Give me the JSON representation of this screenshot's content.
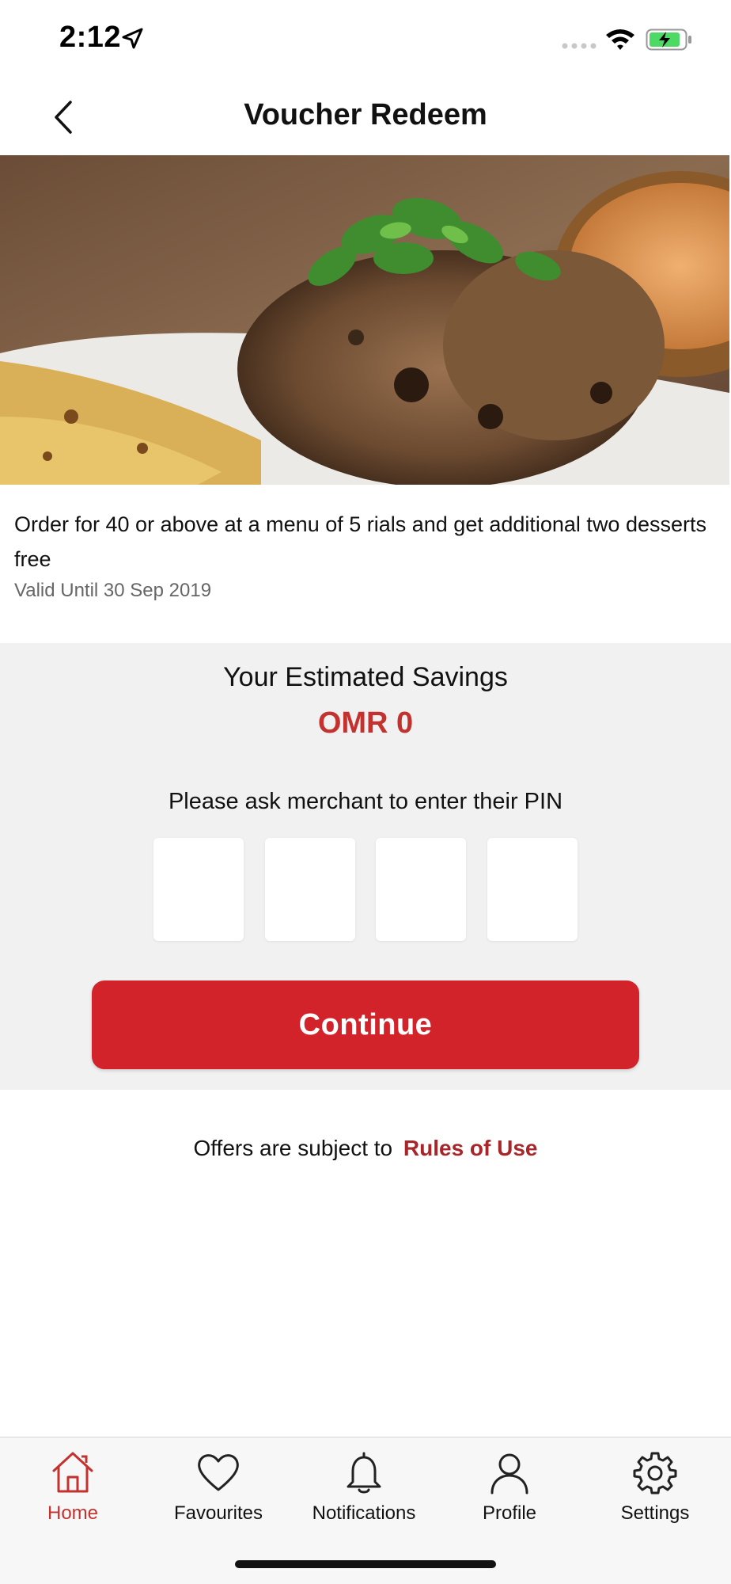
{
  "status_bar": {
    "time": "2:12",
    "icons": [
      "location-arrow-icon",
      "signal-dots-icon",
      "wifi-icon",
      "battery-charging-icon"
    ],
    "battery_color": "#4cd964"
  },
  "header": {
    "title": "Voucher Redeem",
    "back_icon": "chevron-left-icon"
  },
  "offer": {
    "description": "Order for 40 or above at a menu of 5 rials and get additional two desserts free",
    "valid_until": "Valid Until 30 Sep 2019"
  },
  "savings": {
    "label": "Your Estimated Savings",
    "value": "OMR 0"
  },
  "pin": {
    "prompt": "Please ask merchant to enter their PIN",
    "digits": [
      "",
      "",
      "",
      ""
    ]
  },
  "continue_label": "Continue",
  "rules": {
    "text": "Offers are subject to",
    "link": "Rules of Use"
  },
  "tabs": [
    {
      "label": "Home",
      "icon": "home-icon",
      "active": true
    },
    {
      "label": "Favourites",
      "icon": "heart-icon",
      "active": false
    },
    {
      "label": "Notifications",
      "icon": "bell-icon",
      "active": false
    },
    {
      "label": "Profile",
      "icon": "user-icon",
      "active": false
    },
    {
      "label": "Settings",
      "icon": "gear-icon",
      "active": false
    }
  ],
  "colors": {
    "accent": "#d2232b",
    "accent_text": "#c3322f",
    "link": "#a8262a",
    "panel_bg": "#f1f1f1"
  }
}
